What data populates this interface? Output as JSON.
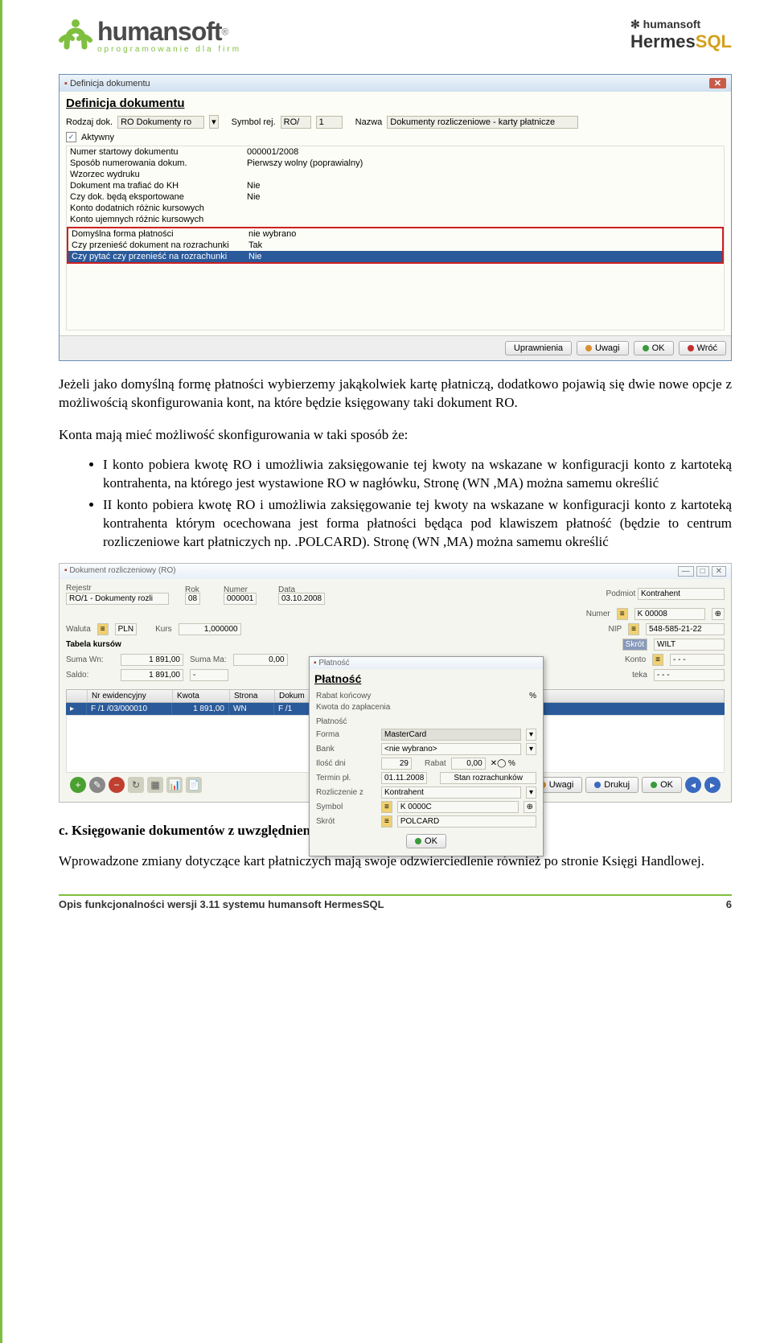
{
  "header": {
    "logo_main": "humansoft",
    "logo_reg": "®",
    "logo_tagline": "oprogramowanie   dla   firm",
    "logo_right_top": "✻ humansoft",
    "logo_right_main": "Hermes",
    "logo_right_sql": "SQL"
  },
  "win1": {
    "title": "Definicja dokumentu",
    "heading": "Definicja dokumentu",
    "rodzaj_label": "Rodzaj dok.",
    "rodzaj_val": "RO Dokumenty ro",
    "symbol_label": "Symbol rej.",
    "symbol_val": "RO/",
    "symbol_num": "1",
    "nazwa_label": "Nazwa",
    "nazwa_val": "Dokumenty rozliczeniowe - karty płatnicze",
    "aktywny_label": "Aktywny",
    "rows": [
      {
        "l": "Numer startowy dokumentu",
        "v": "000001/2008"
      },
      {
        "l": "Sposób numerowania dokum.",
        "v": "Pierwszy wolny  (poprawialny)"
      },
      {
        "l": "Wzorzec wydruku",
        "v": ""
      },
      {
        "l": "Dokument ma trafiać do KH",
        "v": "Nie"
      },
      {
        "l": "Czy dok. będą eksportowane",
        "v": "Nie"
      },
      {
        "l": "Konto dodatnich różnic kursowych",
        "v": ""
      },
      {
        "l": "Konto ujemnych różnic kursowych",
        "v": ""
      }
    ],
    "boxed": [
      {
        "l": "Domyślna forma płatności",
        "v": "nie wybrano"
      },
      {
        "l": "Czy przenieść dokument na rozrachunki",
        "v": "Tak"
      },
      {
        "l": "Czy pytać czy przenieść na rozrachunki",
        "v": "Nie",
        "sel": true
      }
    ],
    "buttons": {
      "uprawnienia": "Uprawnienia",
      "uwagi": "Uwagi",
      "ok": "OK",
      "wroc": "Wróć"
    }
  },
  "para1": "Jeżeli jako domyślną formę płatności wybierzemy jakąkolwiek kartę płatniczą, dodatkowo pojawią się dwie nowe opcje z możliwością skonfigurowania kont, na które będzie księgowany taki dokument RO.",
  "para2": "Konta mają mieć możliwość skonfigurowania w taki sposób że:",
  "bullets": [
    "I konto  pobiera kwotę RO i umożliwia zaksięgowanie tej kwoty na wskazane w konfiguracji konto z kartoteką kontrahenta, na którego jest wystawione RO w  nagłówku, Stronę (WN ,MA) można samemu określić",
    "II konto pobiera kwotę RO i umożliwia zaksięgowanie tej kwoty na wskazane w konfiguracji konto z kartoteką kontrahenta którym ocechowana jest forma płatności będąca pod klawiszem płatność (będzie to centrum rozliczeniowe kart płatniczych np. .POLCARD). Stronę (WN ,MA) można samemu określić"
  ],
  "win2": {
    "title": "Dokument rozliczeniowy (RO)",
    "top": {
      "rejestr_l": "Rejestr",
      "rejestr_v": "RO/1 - Dokumenty rozli",
      "rok_l": "Rok",
      "rok_v": "08",
      "numer_l": "Numer",
      "numer_v": "000001",
      "data_l": "Data",
      "data_v": "03.10.2008",
      "podmiot_l": "Podmiot",
      "podmiot_v": "Kontrahent",
      "numer2_l": "Numer",
      "numer2_v": "K  00008",
      "nip_l": "NIP",
      "nip_v": "548-585-21-22",
      "skrot_l": "Skrót",
      "skrot_v": "WILT",
      "waluta_l": "Waluta",
      "waluta_v": "PLN",
      "kurs_l": "Kurs",
      "kurs_v": "1,000000",
      "tabela_l": "Tabela kursów",
      "sumawn_l": "Suma Wn:",
      "sumawn_v": "1 891,00",
      "summa_l": "Suma Ma:",
      "summa_v": "0,00",
      "saldo_l": "Saldo:",
      "saldo_v": "1 891,00",
      "konto_l": "Konto",
      "teka_l": "teka"
    },
    "grid": {
      "h1": "Nr ewidencyjny",
      "h2": "Kwota",
      "h3": "Strona",
      "h4": "Dokum",
      "r1": "F /1 /03/000010",
      "r2": "1 891,00",
      "r3": "WN",
      "r4": "F /1"
    },
    "popup": {
      "title": "Płatność",
      "heading": "Płatność",
      "rabat_l": "Rabat końcowy",
      "pct": "%",
      "kwota_l": "Kwota do zapłacenia",
      "platnosc_l": "Płatność",
      "forma_l": "Forma",
      "forma_v": "MasterCard",
      "bank_l": "Bank",
      "bank_v": "<nie wybrano>",
      "ilosc_l": "Ilość dni",
      "ilosc_v": "29",
      "rabat2_l": "Rabat",
      "rabat2_v": "0,00",
      "termin_l": "Termin pł.",
      "termin_v": "01.11.2008",
      "stan": "Stan rozrachunków",
      "rozl_l": "Rozliczenie z",
      "rozl_v": "Kontrahent",
      "symbol_l": "Symbol",
      "symbol_v": "K  0000C",
      "skrot_l": "Skrót",
      "skrot_v": "POLCARD",
      "ok": "OK"
    },
    "bottom_buttons": {
      "uwagi": "Uwagi",
      "drukuj": "Drukuj",
      "ok": "OK"
    }
  },
  "section_c": {
    "heading": "c.   Księgowanie dokumentów z uwzględnieniem kart płatniczych",
    "text": "Wprowadzone zmiany dotyczące kart płatniczych mają swoje odzwierciedlenie również po stronie Księgi Handlowej."
  },
  "footer": {
    "left": "Opis funkcjonalności wersji 3.11 systemu humansoft HermesSQL",
    "right": "6"
  }
}
